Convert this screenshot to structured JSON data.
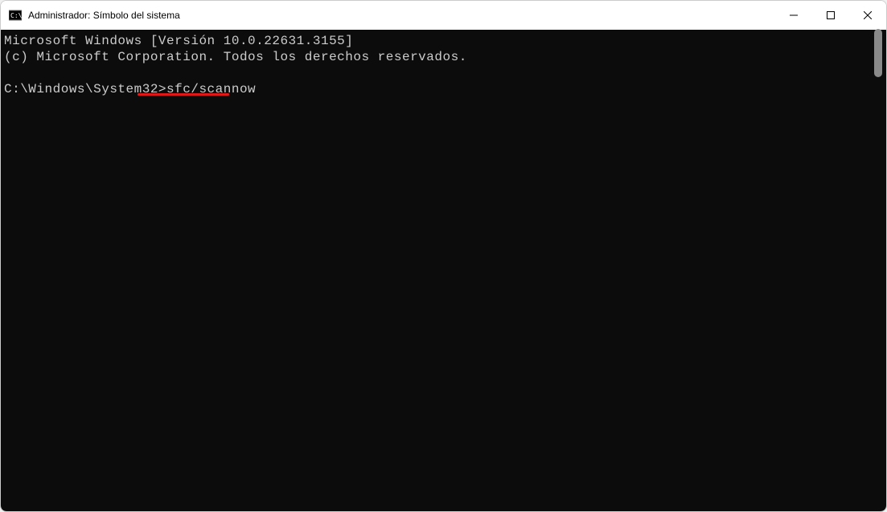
{
  "window": {
    "title": "Administrador: Símbolo del sistema"
  },
  "terminal": {
    "line1": "Microsoft Windows [Versión 10.0.22631.3155]",
    "line2": "(c) Microsoft Corporation. Todos los derechos reservados.",
    "prompt_path": "C:\\Windows\\System32>",
    "prompt_command": "sfc/scannow"
  }
}
